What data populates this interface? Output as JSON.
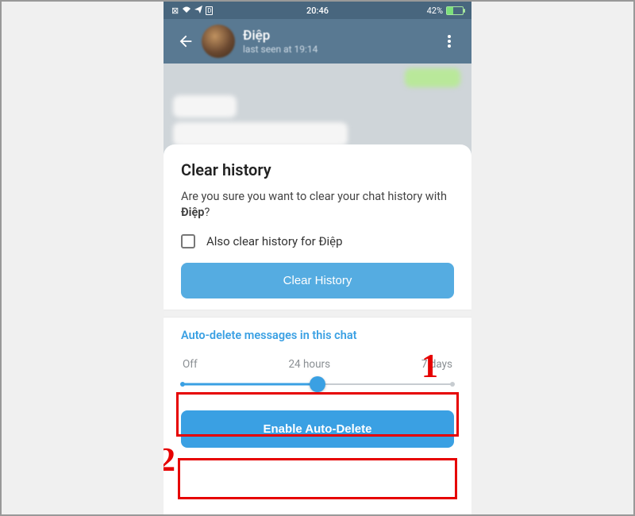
{
  "status_bar": {
    "time": "20:46",
    "battery_pct": "42%",
    "signal_icons": "⌧⚮◀ᴰ"
  },
  "header": {
    "contact_name": "Điệp",
    "last_seen": "last seen at 19:14"
  },
  "modal": {
    "title": "Clear history",
    "description_prefix": "Are you sure you want to clear your chat history with ",
    "description_name": "Điệp",
    "description_suffix": "?",
    "checkbox_label": "Also clear history for Điệp",
    "clear_button": "Clear History",
    "auto_delete_title": "Auto-delete messages in this chat",
    "slider": {
      "options": [
        "Off",
        "24 hours",
        "7 days"
      ],
      "selected_index": 1
    },
    "enable_button": "Enable Auto-Delete"
  },
  "annotations": {
    "num1": "1",
    "num2": "2"
  }
}
